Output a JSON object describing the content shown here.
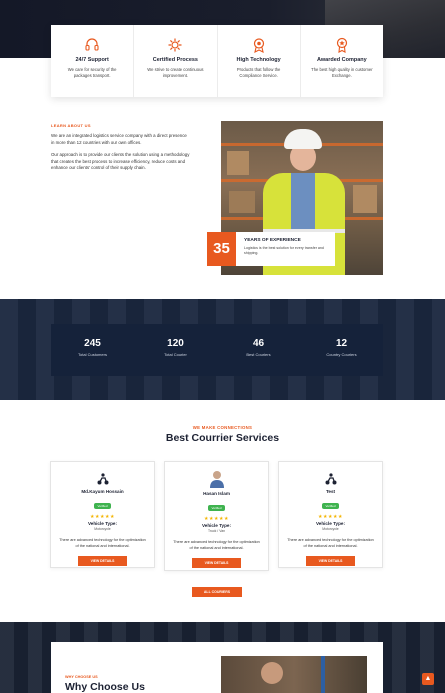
{
  "features": [
    {
      "icon": "headset-icon",
      "title": "24/7 Support",
      "text": "We care for security of the packages transport."
    },
    {
      "icon": "gear-process-icon",
      "title": "Certified Process",
      "text": "We strive to create continuous improvement."
    },
    {
      "icon": "tech-badge-icon",
      "title": "High Technology",
      "text": "Products that follow the Compliance Service."
    },
    {
      "icon": "award-medal-icon",
      "title": "Awarded Company",
      "text": "The best high quality in customer Exchange."
    }
  ],
  "about": {
    "kicker": "LEARN ABOUT US",
    "p1": "We are an integrated logistics service company with a direct presence in more than 12 countries with our own offices.",
    "p2": "Our approach is to provide our clients the solution using a methodology that creates the best process to increase efficiency, reduce costs and enhance our clients' control of their supply chain.",
    "experience_number": "35",
    "experience_title": "YEARS OF EXPERIENCE",
    "experience_text": "Logistics is the best solution for every transfer and shipping."
  },
  "stats": [
    {
      "value": "245",
      "label": "Total Customers"
    },
    {
      "value": "120",
      "label": "Total Courier"
    },
    {
      "value": "46",
      "label": "Best Couriers"
    },
    {
      "value": "12",
      "label": "Country Couriers"
    }
  ],
  "services": {
    "kicker": "WE MAKE CONNECTIONS",
    "title": "Best Courrier Services",
    "view_label": "VIEW DETAILS",
    "all_label": "ALL COURIERS",
    "couriers": [
      {
        "icon": "scooter-icon",
        "name": "Md.Kayum Hossain",
        "badge": "Verified",
        "stars": "★★★★★",
        "vehicle_label": "Vehicle Type:",
        "vehicle": "Motorcycle",
        "desc": "There are advanced technology for the optimization of the national and international."
      },
      {
        "icon": "person-icon",
        "name": "Hasan Islam",
        "badge": "Verified",
        "stars": "★★★★★",
        "vehicle_label": "Vehicle Type:",
        "vehicle": "Truck / Van",
        "desc": "There are advanced technology for the optimization of the national and international."
      },
      {
        "icon": "scooter-icon",
        "name": "Test",
        "badge": "Verified",
        "stars": "★★★★★",
        "vehicle_label": "Vehicle Type:",
        "vehicle": "Motorcycle",
        "desc": "There are advanced technology for the optimization of the national and international."
      }
    ]
  },
  "why": {
    "kicker": "WHY CHOOSE US",
    "title": "Why Choose Us"
  },
  "colors": {
    "accent": "#e8591f",
    "navy": "#1b2840",
    "verified": "#3fb34f",
    "star": "#f4b400"
  }
}
